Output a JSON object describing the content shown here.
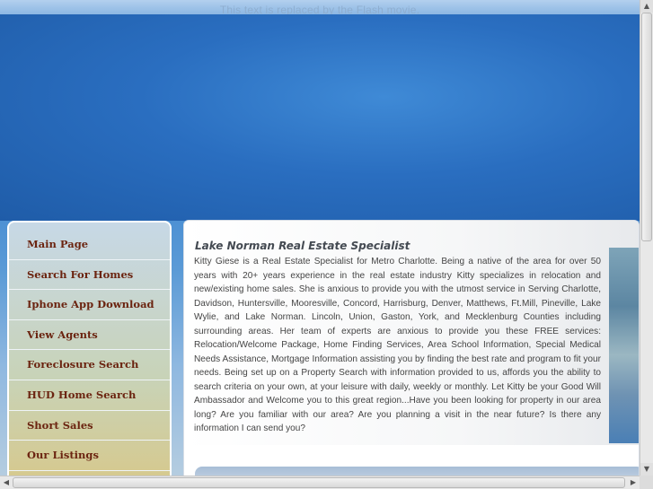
{
  "header": {
    "flash_replacement_text": "This text is replaced by the Flash movie."
  },
  "sidebar": {
    "items": [
      {
        "label": "Main Page"
      },
      {
        "label": "Search For Homes"
      },
      {
        "label": "Iphone App Download"
      },
      {
        "label": "View Agents"
      },
      {
        "label": "Foreclosure Search"
      },
      {
        "label": "HUD Home Search"
      },
      {
        "label": "Short Sales"
      },
      {
        "label": "Our Listings"
      }
    ]
  },
  "main": {
    "title": "Lake Norman Real Estate Specialist",
    "body": "Kitty Giese is a Real Estate Specialist for Metro Charlotte. Being a native of the area for over 50 years with 20+ years experience in the real estate industry Kitty specializes in relocation and new/existing home sales. She is anxious to provide you with the utmost service in Serving Charlotte, Davidson, Huntersville, Mooresville, Concord, Harrisburg, Denver, Matthews, Ft.Mill, Pineville, Lake Wylie, and Lake Norman. Lincoln, Union, Gaston, York, and Mecklenburg Counties including surrounding areas. Her team of experts are anxious to provide you these FREE services: Relocation/Welcome Package, Home Finding Services, Area School Information, Special Medical Needs Assistance, Mortgage Information assisting you by finding the best rate and program to fit your needs. Being set up on a Property Search with information provided to us, affords you the ability to search criteria on your own, at your leisure with daily, weekly or monthly. Let Kitty be your Good Will Ambassador and Welcome you to this great region...Have you been looking for property in our area long? Are you familiar with our area? Are you planning a visit in the near future? Is there any information I can send you?"
  },
  "scrollbars": {
    "up_icon": "triangle-up-icon",
    "down_icon": "triangle-down-icon",
    "left_icon": "triangle-left-icon",
    "right_icon": "triangle-right-icon"
  }
}
